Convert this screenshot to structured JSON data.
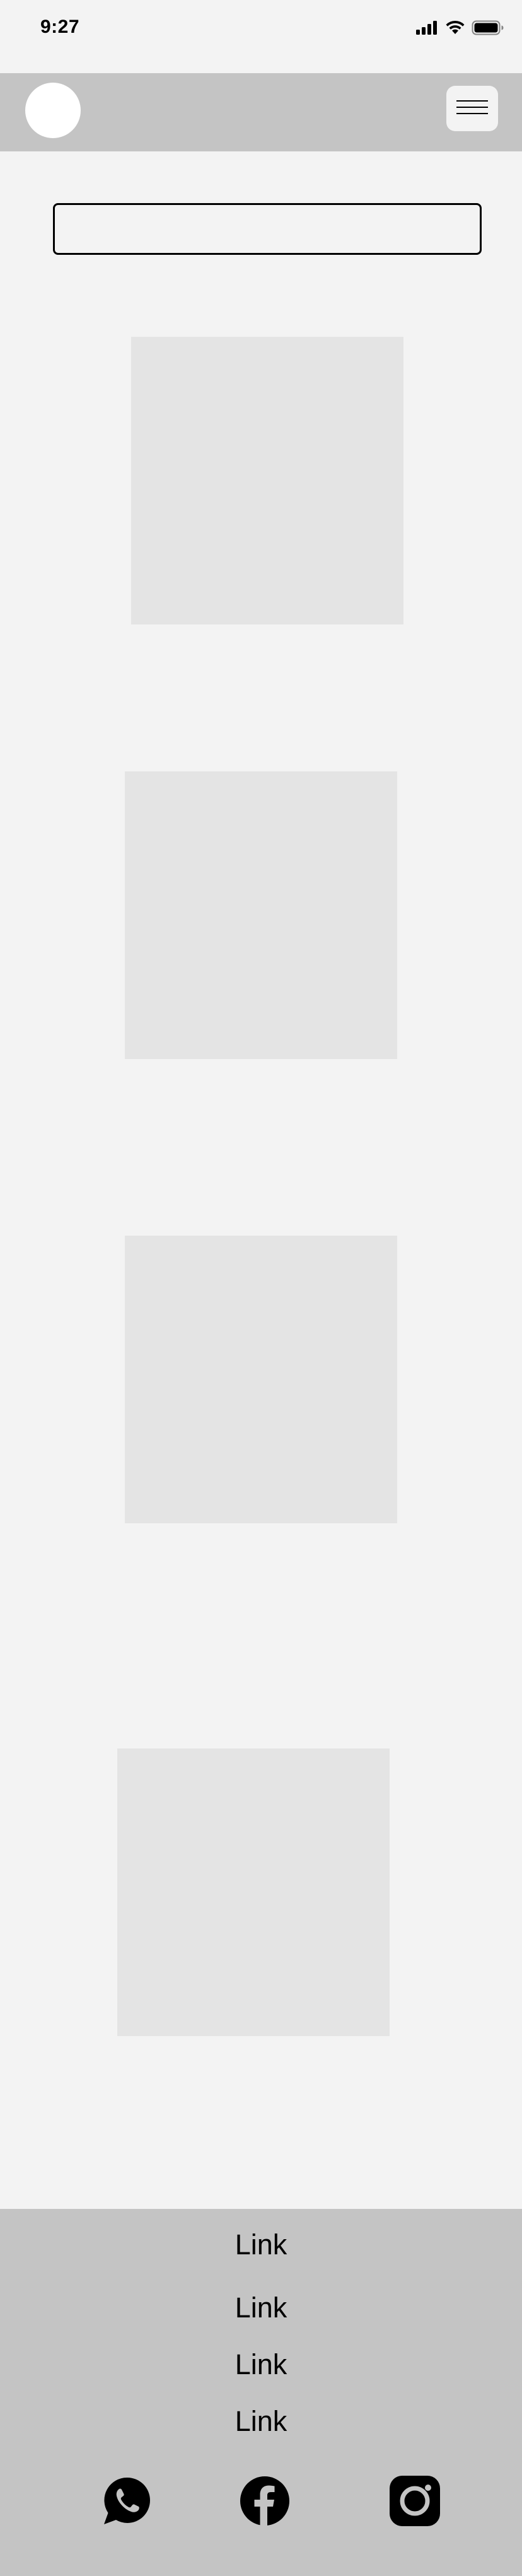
{
  "status_bar": {
    "time": "9:27",
    "icons": [
      "cellular-signal-icon",
      "wifi-icon",
      "battery-icon"
    ]
  },
  "header": {
    "logo": "logo",
    "menu_icon": "hamburger-menu-icon"
  },
  "search": {
    "value": "",
    "placeholder": ""
  },
  "content": {
    "image_placeholders": 4
  },
  "footer": {
    "links": [
      "Link",
      "Link",
      "Link",
      "Link"
    ],
    "social_icons": [
      "whatsapp-icon",
      "facebook-icon",
      "instagram-icon"
    ]
  },
  "colors": {
    "page_background": "#f3f3f3",
    "bar_background": "#c4c4c4",
    "placeholder": "#e4e4e4",
    "foreground": "#000000"
  }
}
